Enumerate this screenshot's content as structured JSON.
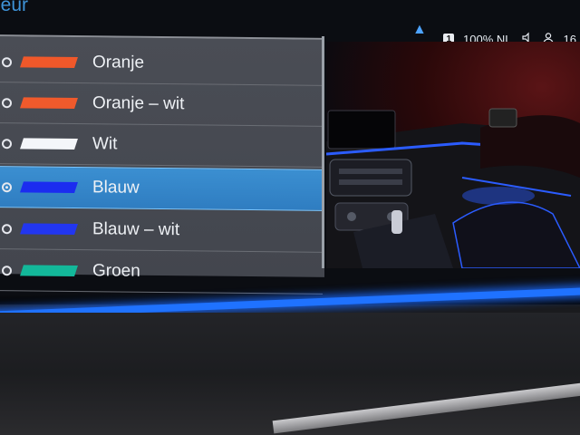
{
  "screen": {
    "title": "leur",
    "status": {
      "up_icon": "chevron-up-icon",
      "sim_badge": "1",
      "volume_text": "100% NL",
      "speaker_icon": "speaker-icon",
      "user_icon": "user-icon",
      "time_fragment": "16"
    }
  },
  "color_list": {
    "items": [
      {
        "label": "Oranje",
        "color": "#f0582a",
        "selected": false
      },
      {
        "label": "Oranje – wit",
        "color": "#f05a2c",
        "selected": false
      },
      {
        "label": "Wit",
        "color": "#f4f6fa",
        "selected": false
      },
      {
        "label": "Blauw",
        "color": "#1b2cf0",
        "selected": true
      },
      {
        "label": "Blauw – wit",
        "color": "#2236f0",
        "selected": false
      },
      {
        "label": "Groen",
        "color": "#13b89a",
        "selected": false
      }
    ]
  },
  "preview": {
    "ambient_color": "#2b5cff"
  }
}
